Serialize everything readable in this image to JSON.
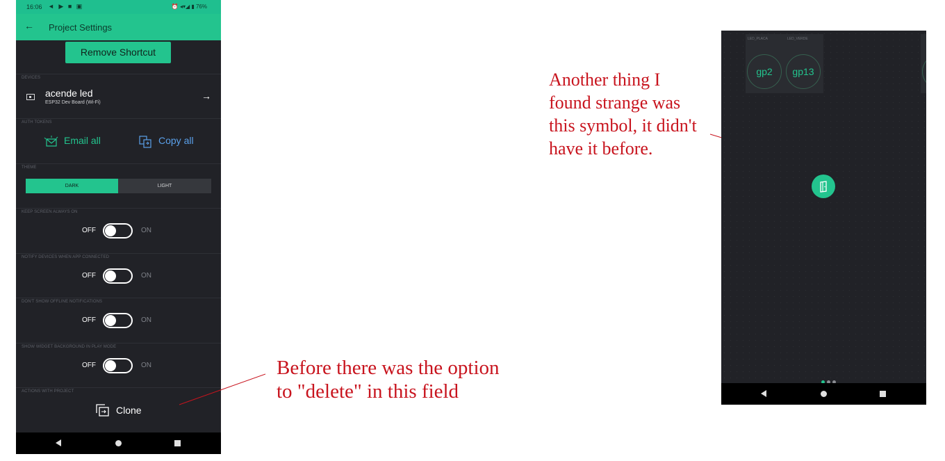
{
  "status_bar": {
    "time": "16:06",
    "left_icons": "◄ ▶ ■ ▣",
    "right_icons": "⏰ ◂▾◢ ▮ 76%"
  },
  "app_bar": {
    "back_icon": "arrow-left-icon",
    "back_glyph": "←",
    "title": "Project Settings"
  },
  "remove_shortcut": "Remove Shortcut",
  "devices": {
    "label": "DEVICES",
    "name": "acende led",
    "board": "ESP32 Dev Board (Wi-Fi)",
    "arrow_glyph": "→"
  },
  "auth_tokens": {
    "label": "AUTH TOKENS",
    "email_all": "Email all",
    "copy_all": "Copy all"
  },
  "theme": {
    "label": "THEME",
    "dark": "DARK",
    "light": "LIGHT",
    "selected": "DARK"
  },
  "toggles": [
    {
      "label": "KEEP SCREEN ALWAYS ON",
      "off": "OFF",
      "on": "ON",
      "state": "off"
    },
    {
      "label": "NOTIFY DEVICES WHEN APP CONNECTED",
      "off": "OFF",
      "on": "ON",
      "state": "off"
    },
    {
      "label": "DON'T SHOW OFFLINE NOTIFICATIONS",
      "off": "OFF",
      "on": "ON",
      "state": "off"
    },
    {
      "label": "SHOW WIDGET BACKGROUND IN PLAY MODE",
      "off": "OFF",
      "on": "ON",
      "state": "off"
    }
  ],
  "actions": {
    "label": "ACTIONS WITH PROJECT",
    "clone": "Clone"
  },
  "annotations": {
    "right_note": [
      "Another thing I",
      "found strange was",
      "this symbol, it didn't",
      "have it before."
    ],
    "bottom_note": [
      "Before there was the option",
      "to \"delete\" in this field"
    ],
    "color": "#c8141e"
  },
  "dashboard": {
    "widget_labels": [
      "LED_PLACA",
      "LED_VERDE"
    ],
    "buttons": [
      "gp2",
      "gp13"
    ],
    "page_dots": {
      "count": 3,
      "active": 0
    }
  },
  "colors": {
    "accent": "#23c48e",
    "background": "#212227",
    "link_blue": "#5aa0ea"
  }
}
